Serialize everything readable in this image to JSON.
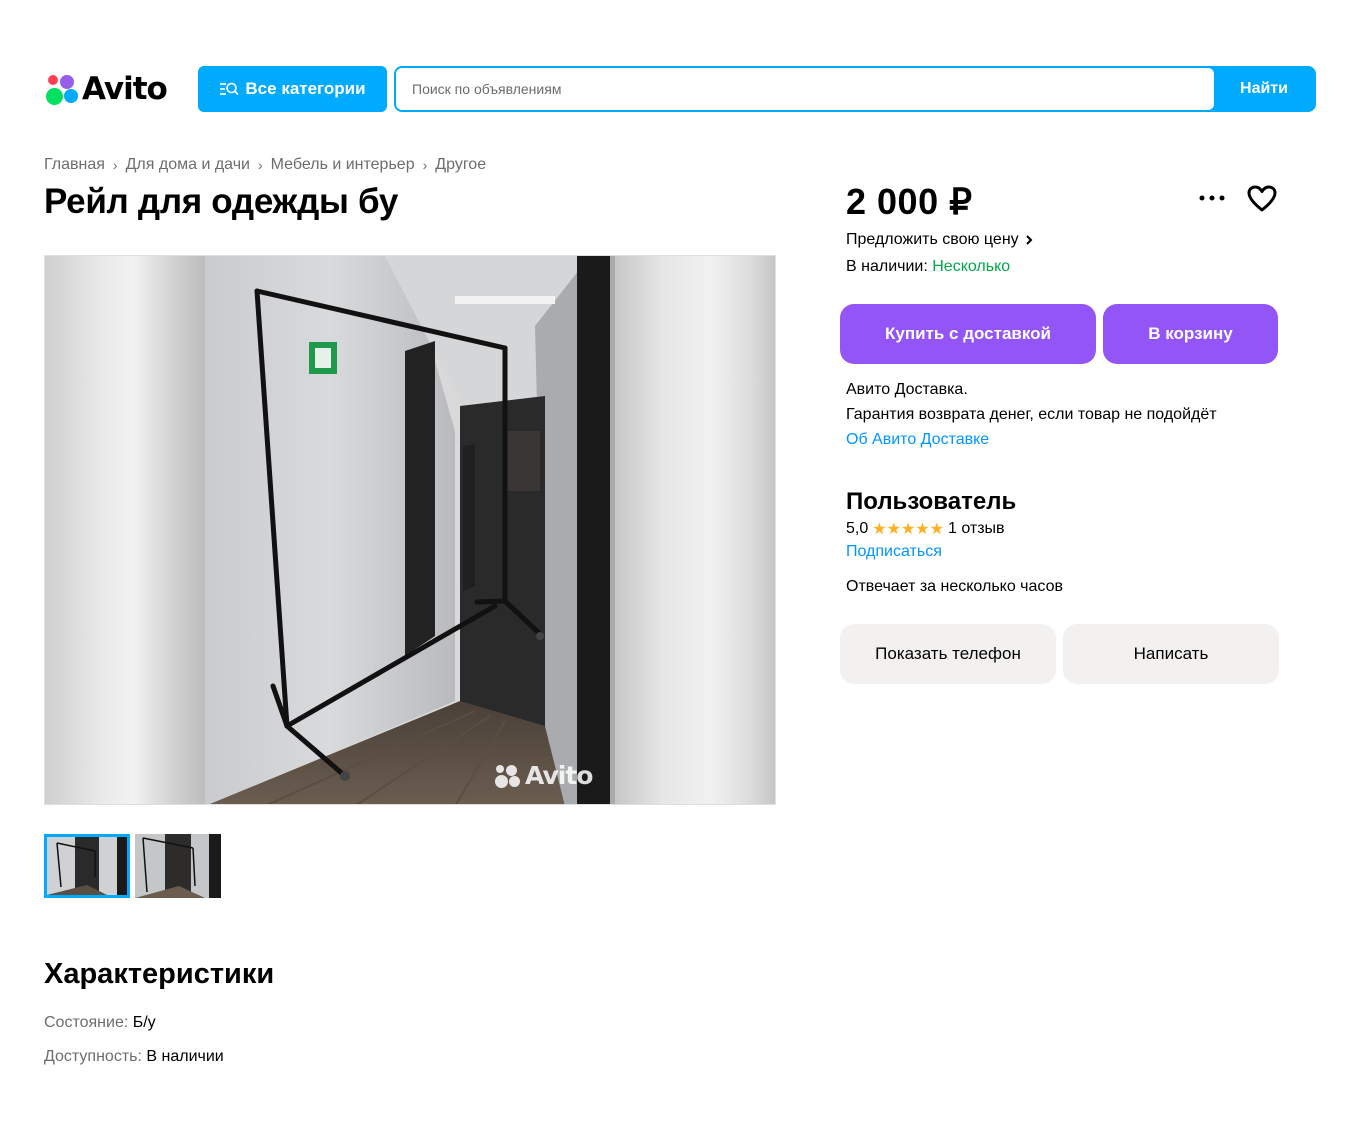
{
  "header": {
    "logo_text": "Avito",
    "categories_label": "Все категории",
    "search_placeholder": "Поиск по объявлениям",
    "search_button": "Найти"
  },
  "breadcrumb": [
    "Главная",
    "Для дома и дачи",
    "Мебель и интерьер",
    "Другое"
  ],
  "listing": {
    "title": "Рейл для одежды бу",
    "watermark": "Avito",
    "thumbnails_count": 2
  },
  "characteristics": {
    "title": "Характеристики",
    "rows": [
      {
        "label": "Состояние: ",
        "value": "Б/у"
      },
      {
        "label": "Доступность: ",
        "value": "В наличии"
      }
    ]
  },
  "purchase": {
    "price": "2 000 ₽",
    "offer_price": "Предложить свою цену",
    "stock_label": "В наличии: ",
    "stock_value": "Несколько",
    "buy_delivery": "Купить с доставкой",
    "to_cart": "В корзину",
    "delivery_line1": "Авито Доставка.",
    "delivery_line2": "Гарантия возврата денег, если товар не подойдёт",
    "delivery_link": "Об Авито Доставке"
  },
  "seller": {
    "name": "Пользователь",
    "rating": "5,0",
    "stars": "★★★★★",
    "reviews": "1 отзыв",
    "subscribe": "Подписаться",
    "reply_time": "Отвечает за несколько часов",
    "show_phone": "Показать телефон",
    "write": "Написать"
  },
  "colors": {
    "accent_blue": "#00aaff",
    "purple": "#9355f5",
    "green": "#02a84a",
    "star": "#ffb021"
  }
}
